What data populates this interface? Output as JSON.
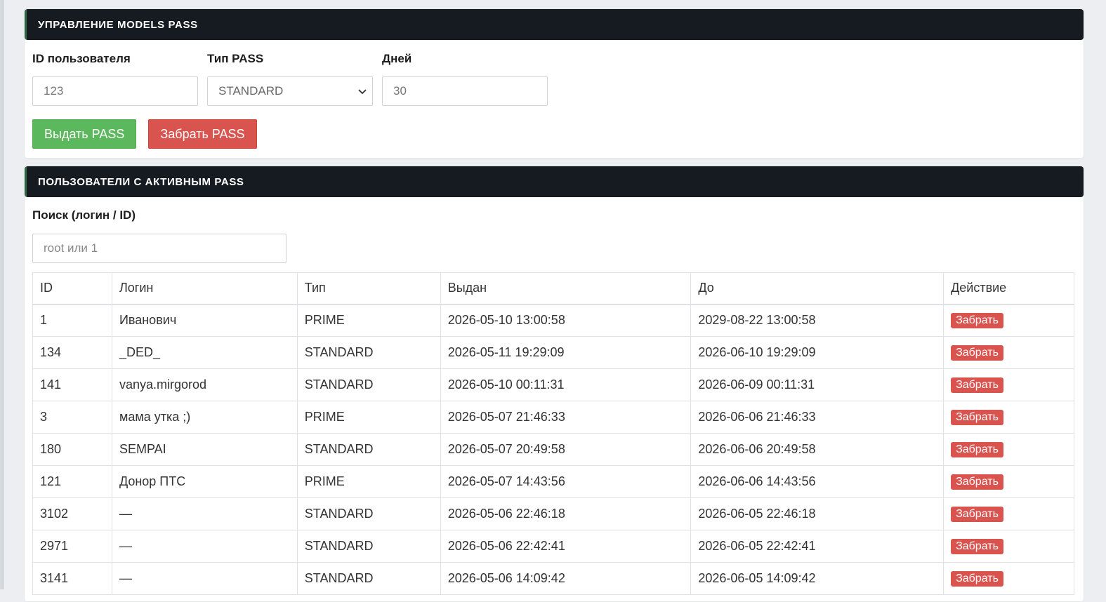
{
  "manage_panel": {
    "title": "УПРАВЛЕНИЕ MODELS PASS",
    "user_id_label": "ID пользователя",
    "user_id_placeholder": "123",
    "pass_type_label": "Тип PASS",
    "pass_type_selected": "STANDARD",
    "days_label": "Дней",
    "days_placeholder": "30",
    "grant_button": "Выдать PASS",
    "revoke_button": "Забрать PASS"
  },
  "active_panel": {
    "title": "ПОЛЬЗОВАТЕЛИ С АКТИВНЫМ PASS",
    "search_label": "Поиск (логин / ID)",
    "search_placeholder": "root или 1",
    "columns": [
      "ID",
      "Логин",
      "Тип",
      "Выдан",
      "До",
      "Действие"
    ],
    "action_label": "Забрать",
    "rows": [
      {
        "id": "1",
        "login": "Иванович",
        "type": "PRIME",
        "issued": "2026-05-10 13:00:58",
        "until": "2029-08-22 13:00:58"
      },
      {
        "id": "134",
        "login": "_DED_",
        "type": "STANDARD",
        "issued": "2026-05-11 19:29:09",
        "until": "2026-06-10 19:29:09"
      },
      {
        "id": "141",
        "login": "vanya.mirgorod",
        "type": "STANDARD",
        "issued": "2026-05-10 00:11:31",
        "until": "2026-06-09 00:11:31"
      },
      {
        "id": "3",
        "login": "мама утка ;)",
        "type": "PRIME",
        "issued": "2026-05-07 21:46:33",
        "until": "2026-06-06 21:46:33"
      },
      {
        "id": "180",
        "login": "SEMPAI",
        "type": "STANDARD",
        "issued": "2026-05-07 20:49:58",
        "until": "2026-06-06 20:49:58"
      },
      {
        "id": "121",
        "login": "Донор ПТС",
        "type": "PRIME",
        "issued": "2026-05-07 14:43:56",
        "until": "2026-06-06 14:43:56"
      },
      {
        "id": "3102",
        "login": "—",
        "type": "STANDARD",
        "issued": "2026-05-06 22:46:18",
        "until": "2026-06-05 22:46:18"
      },
      {
        "id": "2971",
        "login": "—",
        "type": "STANDARD",
        "issued": "2026-05-06 22:42:41",
        "until": "2026-06-05 22:42:41"
      },
      {
        "id": "3141",
        "login": "—",
        "type": "STANDARD",
        "issued": "2026-05-06 14:09:42",
        "until": "2026-06-05 14:09:42"
      }
    ]
  },
  "icons": {
    "select_chevron": "chevron-down-icon"
  },
  "colors": {
    "header_bg": "#161b22",
    "success": "#5cb85c",
    "danger": "#d9534f"
  }
}
